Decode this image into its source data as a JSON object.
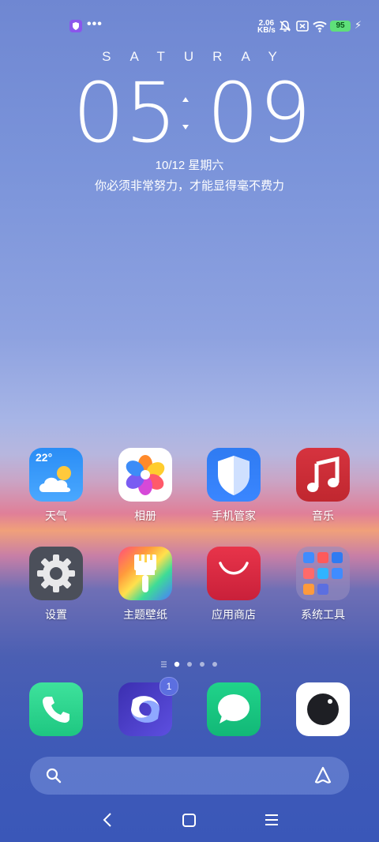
{
  "status_bar": {
    "speed_value": "2.06",
    "speed_unit": "KB/s",
    "battery_level": "95",
    "icons": [
      "shield-icon",
      "more-dots-icon",
      "mute-bell-icon",
      "close-box-icon",
      "wifi-icon",
      "battery-icon",
      "charging-icon"
    ]
  },
  "lockscreen": {
    "day": "SATURAY",
    "hour": "05",
    "minute": "09",
    "date": "10/12 星期六",
    "motto": "你必须非常努力，才能显得毫不费力"
  },
  "weather": {
    "temperature": "22°"
  },
  "apps_row1": [
    {
      "label": "天气",
      "icon": "weather-icon"
    },
    {
      "label": "相册",
      "icon": "gallery-icon"
    },
    {
      "label": "手机管家",
      "icon": "security-shield-icon"
    },
    {
      "label": "音乐",
      "icon": "music-icon"
    }
  ],
  "apps_row2": [
    {
      "label": "设置",
      "icon": "settings-gear-icon"
    },
    {
      "label": "主题壁纸",
      "icon": "theme-brush-icon"
    },
    {
      "label": "应用商店",
      "icon": "app-store-icon"
    },
    {
      "label": "系统工具",
      "icon": "system-tools-folder-icon"
    }
  ],
  "dock": [
    {
      "label": "Phone",
      "icon": "phone-icon"
    },
    {
      "label": "Browser",
      "icon": "browser-swirl-icon",
      "badge": "1"
    },
    {
      "label": "Messages",
      "icon": "message-icon"
    },
    {
      "label": "Camera",
      "icon": "camera-icon"
    }
  ],
  "pager": {
    "pages": 4,
    "active": 1
  },
  "colors": {
    "battery": "#5fe07a",
    "accent": "#5c6fe0"
  }
}
